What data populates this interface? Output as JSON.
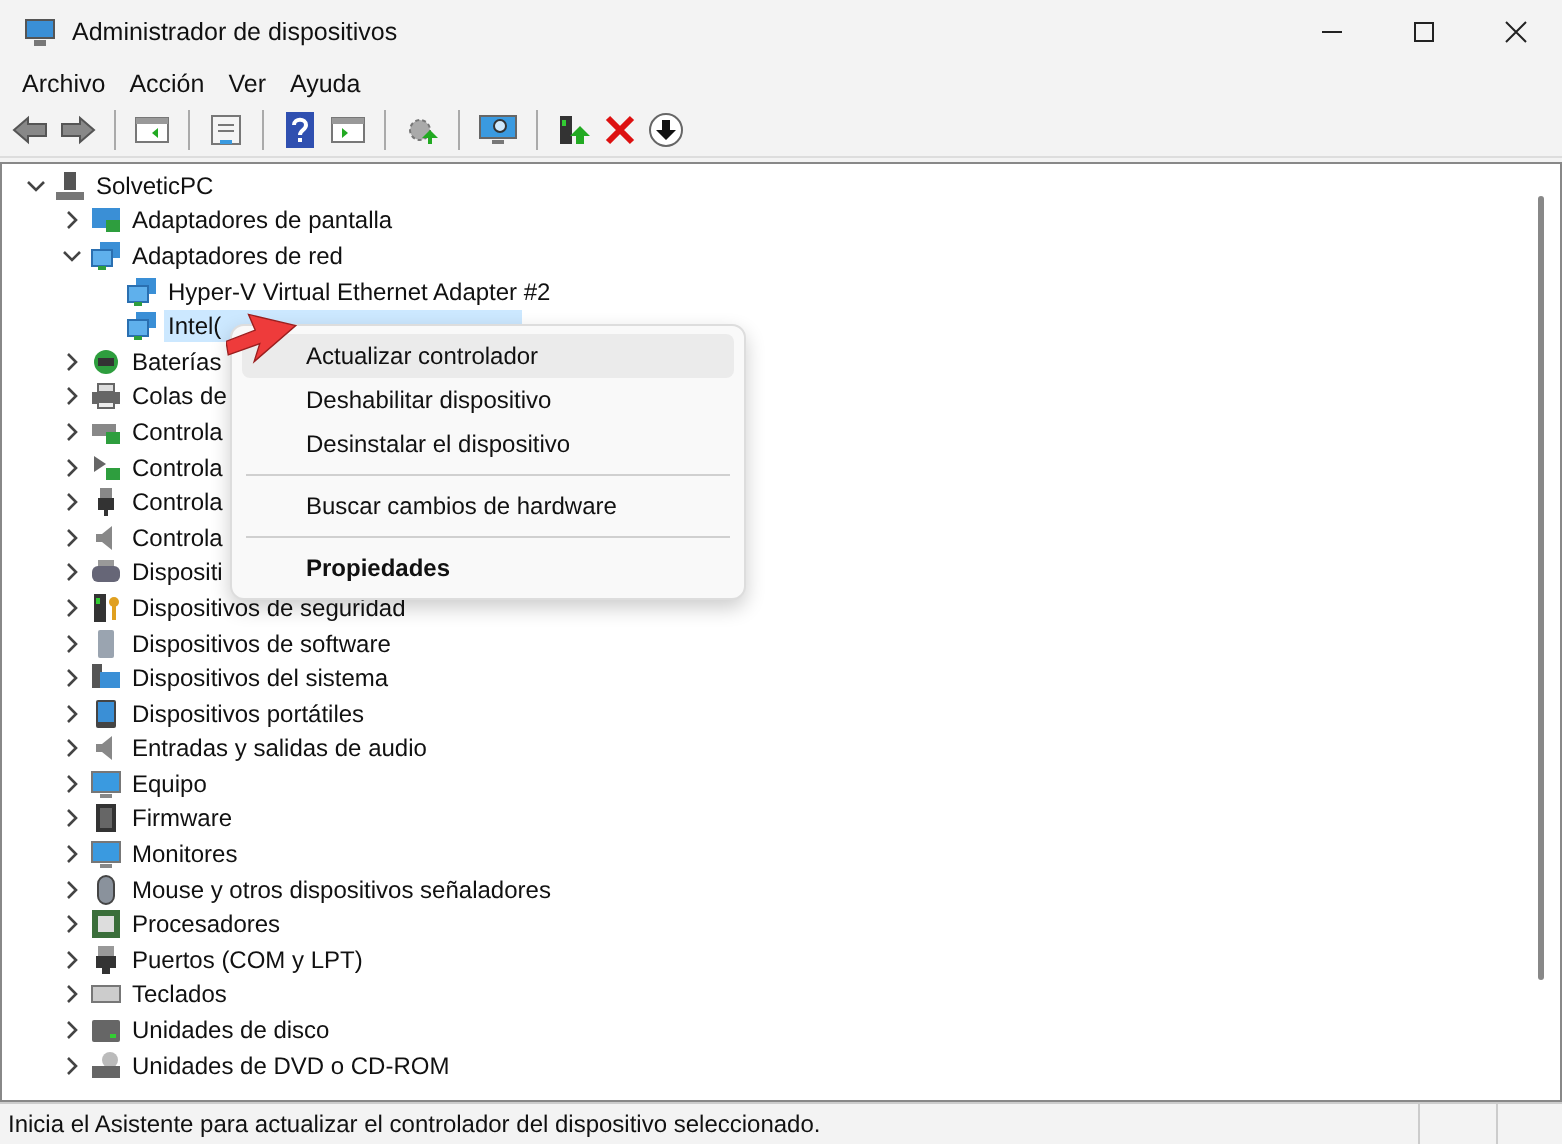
{
  "window": {
    "title": "Administrador de dispositivos"
  },
  "menu_bar": [
    "Archivo",
    "Acción",
    "Ver",
    "Ayuda"
  ],
  "tree": [
    {
      "label": "SolveticPC",
      "kind": "computer",
      "expanded": true,
      "selected": false,
      "children": [
        {
          "label": "Adaptadores de pantalla",
          "kind": "display",
          "expanded": false,
          "selected": false
        },
        {
          "label": "Adaptadores de red",
          "kind": "network",
          "expanded": true,
          "selected": false,
          "children": [
            {
              "label": "Hyper-V Virtual Ethernet Adapter #2",
              "kind": "network",
              "selected": false
            },
            {
              "label": "Intel(",
              "kind": "network",
              "selected": true
            }
          ]
        },
        {
          "label": "Baterías",
          "kind": "battery",
          "expanded": false,
          "selected": false
        },
        {
          "label": "Colas de",
          "kind": "printer",
          "expanded": false,
          "selected": false
        },
        {
          "label": "Controla",
          "kind": "storage",
          "expanded": false,
          "selected": false
        },
        {
          "label": "Controla",
          "kind": "bus",
          "expanded": false,
          "selected": false
        },
        {
          "label": "Controla",
          "kind": "usb",
          "expanded": false,
          "selected": false
        },
        {
          "label": "Controla",
          "kind": "sound",
          "expanded": false,
          "selected": false
        },
        {
          "label": "Dispositi",
          "kind": "hid",
          "expanded": false,
          "selected": false
        },
        {
          "label": "Dispositivos de seguridad",
          "kind": "security",
          "expanded": false,
          "selected": false
        },
        {
          "label": "Dispositivos de software",
          "kind": "software",
          "expanded": false,
          "selected": false
        },
        {
          "label": "Dispositivos del sistema",
          "kind": "system",
          "expanded": false,
          "selected": false
        },
        {
          "label": "Dispositivos portátiles",
          "kind": "portable",
          "expanded": false,
          "selected": false
        },
        {
          "label": "Entradas y salidas de audio",
          "kind": "sound",
          "expanded": false,
          "selected": false
        },
        {
          "label": "Equipo",
          "kind": "monitor",
          "expanded": false,
          "selected": false
        },
        {
          "label": "Firmware",
          "kind": "chip",
          "expanded": false,
          "selected": false
        },
        {
          "label": "Monitores",
          "kind": "monitor",
          "expanded": false,
          "selected": false
        },
        {
          "label": "Mouse y otros dispositivos señaladores",
          "kind": "mouse",
          "expanded": false,
          "selected": false
        },
        {
          "label": "Procesadores",
          "kind": "cpu",
          "expanded": false,
          "selected": false
        },
        {
          "label": "Puertos (COM y LPT)",
          "kind": "port",
          "expanded": false,
          "selected": false
        },
        {
          "label": "Teclados",
          "kind": "keyboard",
          "expanded": false,
          "selected": false
        },
        {
          "label": "Unidades de disco",
          "kind": "disk",
          "expanded": false,
          "selected": false
        },
        {
          "label": "Unidades de DVD o CD-ROM",
          "kind": "dvd",
          "expanded": false,
          "selected": false
        }
      ]
    }
  ],
  "context_menu": [
    {
      "label": "Actualizar controlador",
      "selected": true,
      "bold": false,
      "separator_before": false
    },
    {
      "label": "Deshabilitar dispositivo",
      "selected": false,
      "bold": false,
      "separator_before": false
    },
    {
      "label": "Desinstalar el dispositivo",
      "selected": false,
      "bold": false,
      "separator_before": false
    },
    {
      "label": "Buscar cambios de hardware",
      "selected": false,
      "bold": false,
      "separator_before": true
    },
    {
      "label": "Propiedades",
      "selected": false,
      "bold": true,
      "separator_before": true
    }
  ],
  "status_bar": "Inicia el Asistente para actualizar el controlador del dispositivo seleccionado."
}
